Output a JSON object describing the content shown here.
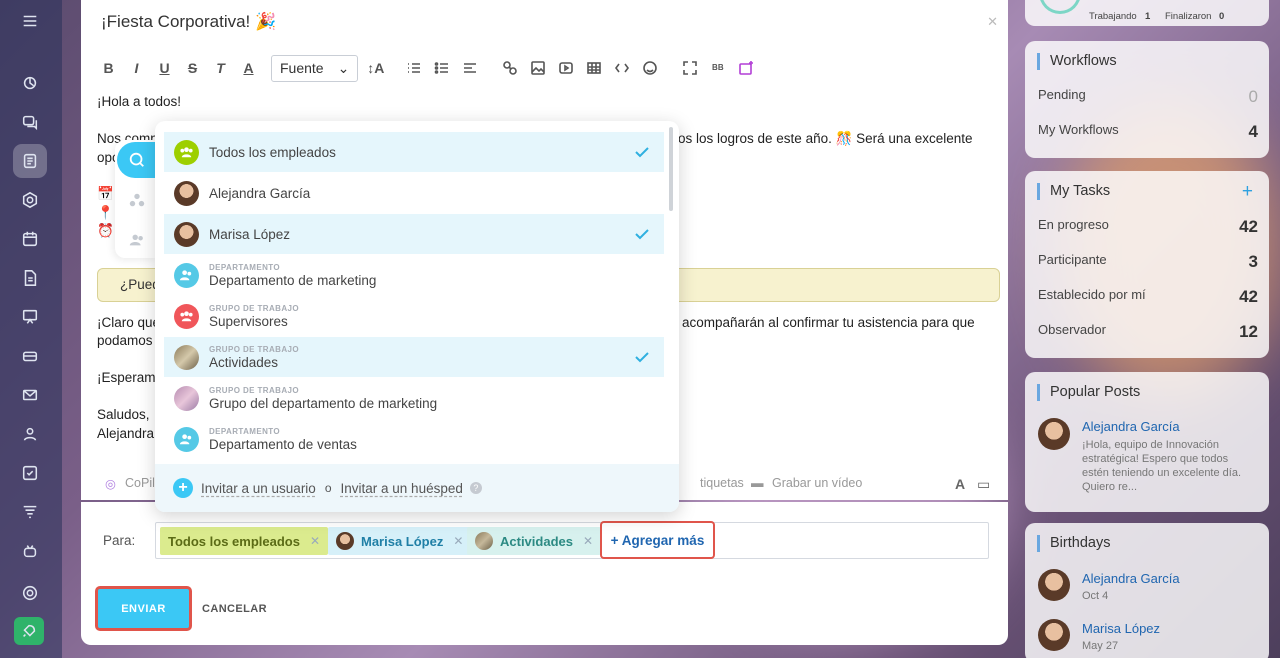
{
  "rail": {
    "icons": [
      "menu-icon",
      "crm-icon",
      "chat-icon",
      "feed-icon",
      "hexagon-icon",
      "calendar-icon",
      "docs-icon",
      "board-icon",
      "storage-icon",
      "mail-icon",
      "users-icon",
      "tasks-icon",
      "filter-icon",
      "robot-icon",
      "settings-icon",
      "rocket-icon"
    ]
  },
  "editor": {
    "title": "¡Fiesta Corporativa! 🎉",
    "font_select": "Fuente",
    "line1": "¡Hola a todos!",
    "line2a": "Nos comp",
    "line2b": "os los logros de este año. 🎊 Será una excelente",
    "line3": "opo",
    "line4": "📅 F",
    "line5": "📍 Luga",
    "line6": "⏰ H",
    "quote": "¿Pued",
    "line7a": "¡Claro que",
    "line7b": "acompañarán al confirmar tu asistencia para que",
    "line8": "podamos",
    "line9": "¡Esperam",
    "line10": "Saludos,",
    "line11": "Alejandra",
    "bottom_copilot": "CoPil",
    "bottom_tags": "tiquetas",
    "bottom_video": "Grabar un vídeo"
  },
  "popup": {
    "items": [
      {
        "label": "Todos los empleados",
        "sub": "",
        "selected": true,
        "icon": "group-icon"
      },
      {
        "label": "Alejandra García",
        "sub": "",
        "selected": false,
        "icon": "avatar"
      },
      {
        "label": "Marisa López",
        "sub": "",
        "selected": true,
        "icon": "avatar"
      },
      {
        "label": "Departamento de marketing",
        "sub": "DEPARTAMENTO",
        "selected": false,
        "icon": "group-icon"
      },
      {
        "label": "Supervisores",
        "sub": "GRUPO DE TRABAJO",
        "selected": false,
        "icon": "group-icon"
      },
      {
        "label": "Actividades",
        "sub": "GRUPO DE TRABAJO",
        "selected": true,
        "icon": "avatar"
      },
      {
        "label": "Grupo del departamento de marketing",
        "sub": "GRUPO DE TRABAJO",
        "selected": false,
        "icon": "avatar"
      },
      {
        "label": "Departamento de ventas",
        "sub": "DEPARTAMENTO",
        "selected": false,
        "icon": "group-icon"
      }
    ],
    "invite_user": "Invitar a un usuario",
    "or": "o",
    "invite_guest": "Invitar a un huésped"
  },
  "to": {
    "label": "Para:",
    "chips": [
      "Todos los empleados",
      "Marisa López",
      "Actividades"
    ],
    "add_more": "+ Agregar más",
    "send": "ENVIAR",
    "cancel": "CANCELAR"
  },
  "top_widget": {
    "working_label": "Trabajando",
    "working_count": "1",
    "finished_label": "Finalizaron",
    "finished_count": "0"
  },
  "workflows": {
    "title": "Workflows",
    "rows": [
      {
        "label": "Pending",
        "value": "0"
      },
      {
        "label": "My Workflows",
        "value": "4"
      }
    ]
  },
  "tasks": {
    "title": "My Tasks",
    "rows": [
      {
        "label": "En progreso",
        "value": "42"
      },
      {
        "label": "Participante",
        "value": "3"
      },
      {
        "label": "Establecido por mí",
        "value": "42"
      },
      {
        "label": "Observador",
        "value": "12"
      }
    ]
  },
  "popular": {
    "title": "Popular Posts",
    "author": "Alejandra García",
    "text": "¡Hola, equipo de Innovación estratégica! Espero que todos estén teniendo un excelente día. Quiero re..."
  },
  "birthdays": {
    "title": "Birthdays",
    "people": [
      {
        "name": "Alejandra García",
        "date": "Oct 4"
      },
      {
        "name": "Marisa López",
        "date": "May 27"
      }
    ]
  },
  "colors": {
    "accent": "#3bc8f5",
    "highlight": "#e0554b",
    "link": "#2066b0"
  }
}
